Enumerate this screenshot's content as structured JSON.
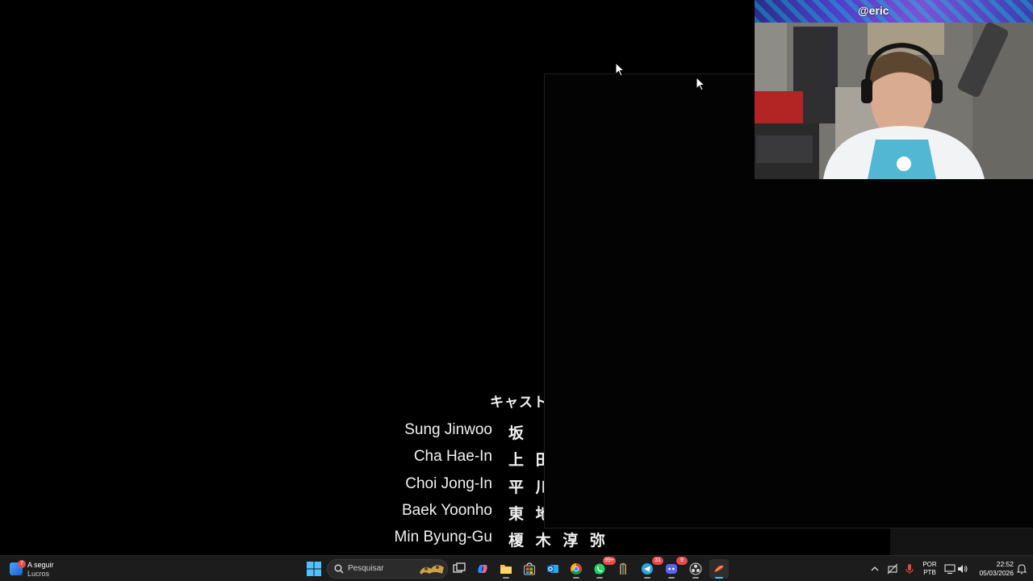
{
  "credits": {
    "heading": "キャスト",
    "rows": [
      {
        "role": "Sung Jinwoo",
        "actor": "坂"
      },
      {
        "role": "Cha Hae-In",
        "actor": "上 田"
      },
      {
        "role": "Choi Jong-In",
        "actor": "平 川"
      },
      {
        "role": "Baek Yoonho",
        "actor": "東 地"
      },
      {
        "role": "Min Byung-Gu",
        "actor": "榎 木 淳 弥"
      }
    ]
  },
  "webcam": {
    "handle": "@eric",
    "banner_colors": [
      "#2a2d8c",
      "#7b52d6",
      "#00dcdc"
    ]
  },
  "taskbar": {
    "widget": {
      "title": "A seguir",
      "subtitle": "Lucros",
      "badge": "7"
    },
    "search_placeholder": "Pesquisar",
    "apps": [
      {
        "name": "task-view",
        "icon": "task-view-icon"
      },
      {
        "name": "copilot",
        "icon": "copilot-icon"
      },
      {
        "name": "file-explorer",
        "icon": "folder-icon"
      },
      {
        "name": "microsoft-store",
        "icon": "store-icon"
      },
      {
        "name": "outlook",
        "icon": "outlook-icon"
      },
      {
        "name": "chrome",
        "icon": "chrome-icon"
      },
      {
        "name": "whatsapp",
        "icon": "whatsapp-icon",
        "badge": "99+"
      },
      {
        "name": "app-8",
        "icon": "app-icon"
      },
      {
        "name": "telegram",
        "icon": "telegram-icon",
        "badge": "31"
      },
      {
        "name": "discord",
        "icon": "discord-icon",
        "badge": "9"
      },
      {
        "name": "obs",
        "icon": "obs-icon"
      },
      {
        "name": "active-app",
        "icon": "app-icon"
      }
    ],
    "language": {
      "line1": "POR",
      "line2": "PTB"
    },
    "clock": {
      "time": "22:52",
      "date": "05/03/2026"
    }
  },
  "colors": {
    "taskbar_bg": "#1c1c1c",
    "accent": "#4cc2ff",
    "badge": "#e84a4a"
  }
}
